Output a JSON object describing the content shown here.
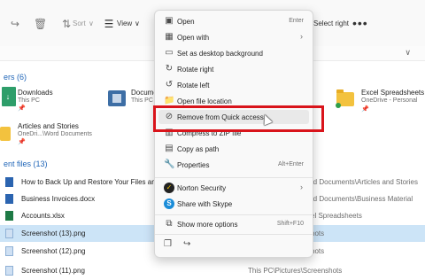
{
  "toolbar": {
    "sort_label": "Sort",
    "view_label": "View",
    "right_label": "Select right",
    "more_label": "•••"
  },
  "quick_access": {
    "header": "ers (6)",
    "tiles": [
      {
        "name": "Downloads",
        "sub": "This PC"
      },
      {
        "name": "Docume",
        "sub": "This PC"
      },
      {
        "name": "Excel Spreadsheets",
        "sub": "OneDrive - Personal"
      },
      {
        "name": "Articles and Stories",
        "sub": "OneDri...\\Word Documents"
      }
    ]
  },
  "recent": {
    "header": "ent files (13)",
    "rows": [
      {
        "name": "How to Back Up and Restore Your Files and Documents",
        "location": "rd Documents\\Articles and Stories",
        "type": "doc"
      },
      {
        "name": "Business Invoices.docx",
        "location": "rd Documents\\Business Material",
        "type": "doc"
      },
      {
        "name": "Accounts.xlsx",
        "location": "el Spreadsheets",
        "type": "xls"
      },
      {
        "name": "Screenshot (13).png",
        "location": "hots",
        "type": "img",
        "selected": true
      },
      {
        "name": "Screenshot (12).png",
        "location": "hots",
        "type": "img"
      },
      {
        "name": "Screenshot (11).png",
        "location": "This PC\\Pictures\\Screenshots",
        "type": "img"
      }
    ]
  },
  "context_menu": {
    "items": [
      {
        "label": "Open",
        "shortcut": "Enter",
        "icon": "open-icon"
      },
      {
        "label": "Open with",
        "submenu": true,
        "icon": "open-with-icon"
      },
      {
        "label": "Set as desktop background",
        "icon": "desktop-background-icon"
      },
      {
        "label": "Rotate right",
        "icon": "rotate-right-icon"
      },
      {
        "label": "Rotate left",
        "icon": "rotate-left-icon"
      },
      {
        "label": "Open file location",
        "icon": "folder-location-icon"
      },
      {
        "label": "Remove from Quick access",
        "icon": "unpin-icon"
      },
      {
        "label": "Compress to ZIP file",
        "icon": "zip-icon"
      },
      {
        "label": "Copy as path",
        "icon": "copy-path-icon"
      },
      {
        "label": "Properties",
        "shortcut": "Alt+Enter",
        "icon": "properties-icon"
      },
      {
        "label": "Norton Security",
        "submenu": true,
        "icon": "norton-icon"
      },
      {
        "label": "Share with Skype",
        "icon": "skype-icon"
      },
      {
        "label": "Show more options",
        "shortcut": "Shift+F10",
        "icon": "more-options-icon"
      }
    ],
    "highlight_color": "#d9141b"
  }
}
